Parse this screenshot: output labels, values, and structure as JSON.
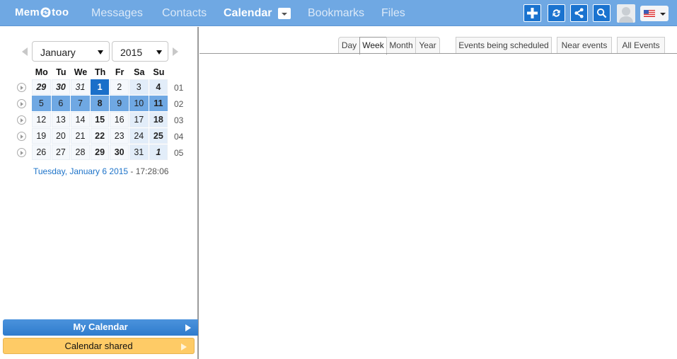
{
  "app": {
    "logo_left": "Mem",
    "logo_right": "too"
  },
  "nav": {
    "messages": "Messages",
    "contacts": "Contacts",
    "calendar": "Calendar",
    "bookmarks": "Bookmarks",
    "files": "Files"
  },
  "toolbar": {
    "icons": [
      "plus-icon",
      "sync-icon",
      "share-icon",
      "search-icon",
      "avatar",
      "us-flag-icon"
    ],
    "accent": "#1a73cf",
    "topbar_color": "#6fa8e3"
  },
  "minical": {
    "month": "January",
    "year": "2015",
    "weekdays": [
      "Mo",
      "Tu",
      "We",
      "Th",
      "Fr",
      "Sa",
      "Su"
    ],
    "weeks": [
      {
        "num": "01",
        "days": [
          {
            "d": "29",
            "s": "bold italic"
          },
          {
            "d": "30",
            "s": "bold italic"
          },
          {
            "d": "31",
            "s": "italic"
          },
          {
            "d": "1",
            "s": "today"
          },
          {
            "d": "2",
            "s": ""
          },
          {
            "d": "3",
            "s": "we"
          },
          {
            "d": "4",
            "s": "we bold"
          }
        ]
      },
      {
        "num": "02",
        "days": [
          {
            "d": "5",
            "s": "sel"
          },
          {
            "d": "6",
            "s": "sel"
          },
          {
            "d": "7",
            "s": "sel"
          },
          {
            "d": "8",
            "s": "sel bold"
          },
          {
            "d": "9",
            "s": "sel"
          },
          {
            "d": "10",
            "s": "sel"
          },
          {
            "d": "11",
            "s": "sel bold"
          }
        ]
      },
      {
        "num": "03",
        "days": [
          {
            "d": "12",
            "s": ""
          },
          {
            "d": "13",
            "s": ""
          },
          {
            "d": "14",
            "s": ""
          },
          {
            "d": "15",
            "s": "bold"
          },
          {
            "d": "16",
            "s": ""
          },
          {
            "d": "17",
            "s": "we"
          },
          {
            "d": "18",
            "s": "we bold"
          }
        ]
      },
      {
        "num": "04",
        "days": [
          {
            "d": "19",
            "s": ""
          },
          {
            "d": "20",
            "s": ""
          },
          {
            "d": "21",
            "s": ""
          },
          {
            "d": "22",
            "s": "bold"
          },
          {
            "d": "23",
            "s": ""
          },
          {
            "d": "24",
            "s": "we"
          },
          {
            "d": "25",
            "s": "we bold"
          }
        ]
      },
      {
        "num": "05",
        "days": [
          {
            "d": "26",
            "s": ""
          },
          {
            "d": "27",
            "s": ""
          },
          {
            "d": "28",
            "s": ""
          },
          {
            "d": "29",
            "s": "bold"
          },
          {
            "d": "30",
            "s": "bold"
          },
          {
            "d": "31",
            "s": "we"
          },
          {
            "d": "1",
            "s": "we bold italic"
          }
        ]
      }
    ],
    "date_text": "Tuesday, January 6 2015",
    "time_text": " - 17:28:06"
  },
  "calendars": {
    "mine": "My Calendar",
    "shared": "Calendar shared"
  },
  "views": {
    "day": "Day",
    "week": "Week",
    "month": "Month",
    "year": "Year",
    "active": "Week"
  },
  "filters": {
    "scheduled": "Events being scheduled",
    "near": "Near events",
    "all": "All Events"
  }
}
